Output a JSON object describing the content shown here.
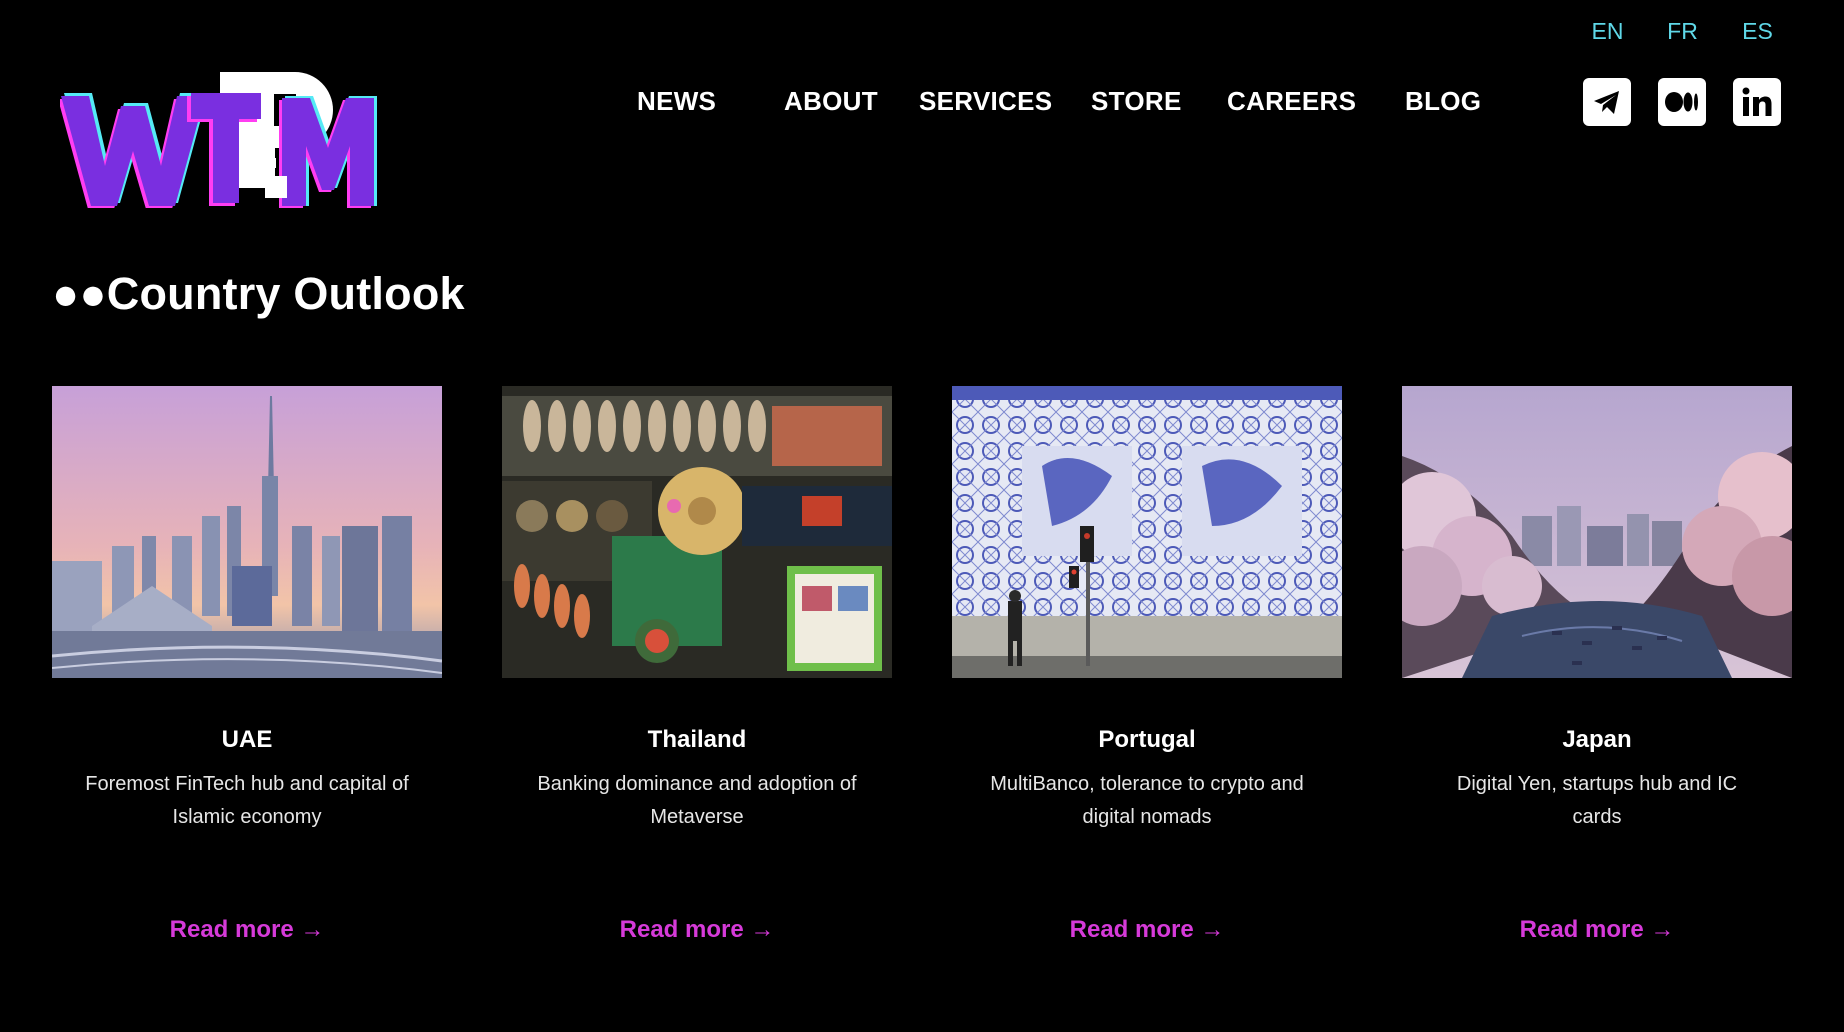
{
  "header": {
    "logo_text": "WTPM",
    "languages": [
      "EN",
      "FR",
      "ES"
    ],
    "nav": [
      "NEWS",
      "ABOUT",
      "SERVICES",
      "STORE",
      "CAREERS",
      "BLOG"
    ],
    "social_icons": [
      "telegram-icon",
      "medium-icon",
      "linkedin-icon"
    ]
  },
  "section": {
    "title": "●●Country Outlook"
  },
  "cards": [
    {
      "title": "UAE",
      "description": "Foremost FinTech hub and capital of Islamic economy",
      "link": "Read more →",
      "image": "dubai-skyline-photo"
    },
    {
      "title": "Thailand",
      "description": "Banking dominance and adoption of Metaverse",
      "link": "Read more →",
      "image": "thai-floating-market-photo"
    },
    {
      "title": "Portugal",
      "description": "MultiBanco, tolerance to crypto and digital nomads",
      "link": "Read more →",
      "image": "azulejo-tile-wall-photo"
    },
    {
      "title": "Japan",
      "description": "Digital Yen, startups hub and IC cards",
      "link": "Read more →",
      "image": "cherry-blossom-river-photo"
    }
  ],
  "colors": {
    "background": "#000000",
    "language_link": "#5fd8e8",
    "read_more": "#d63ad9",
    "logo_purple": "#7a2fe0",
    "logo_pink": "#ff3df2",
    "logo_cyan": "#55eaf5"
  }
}
